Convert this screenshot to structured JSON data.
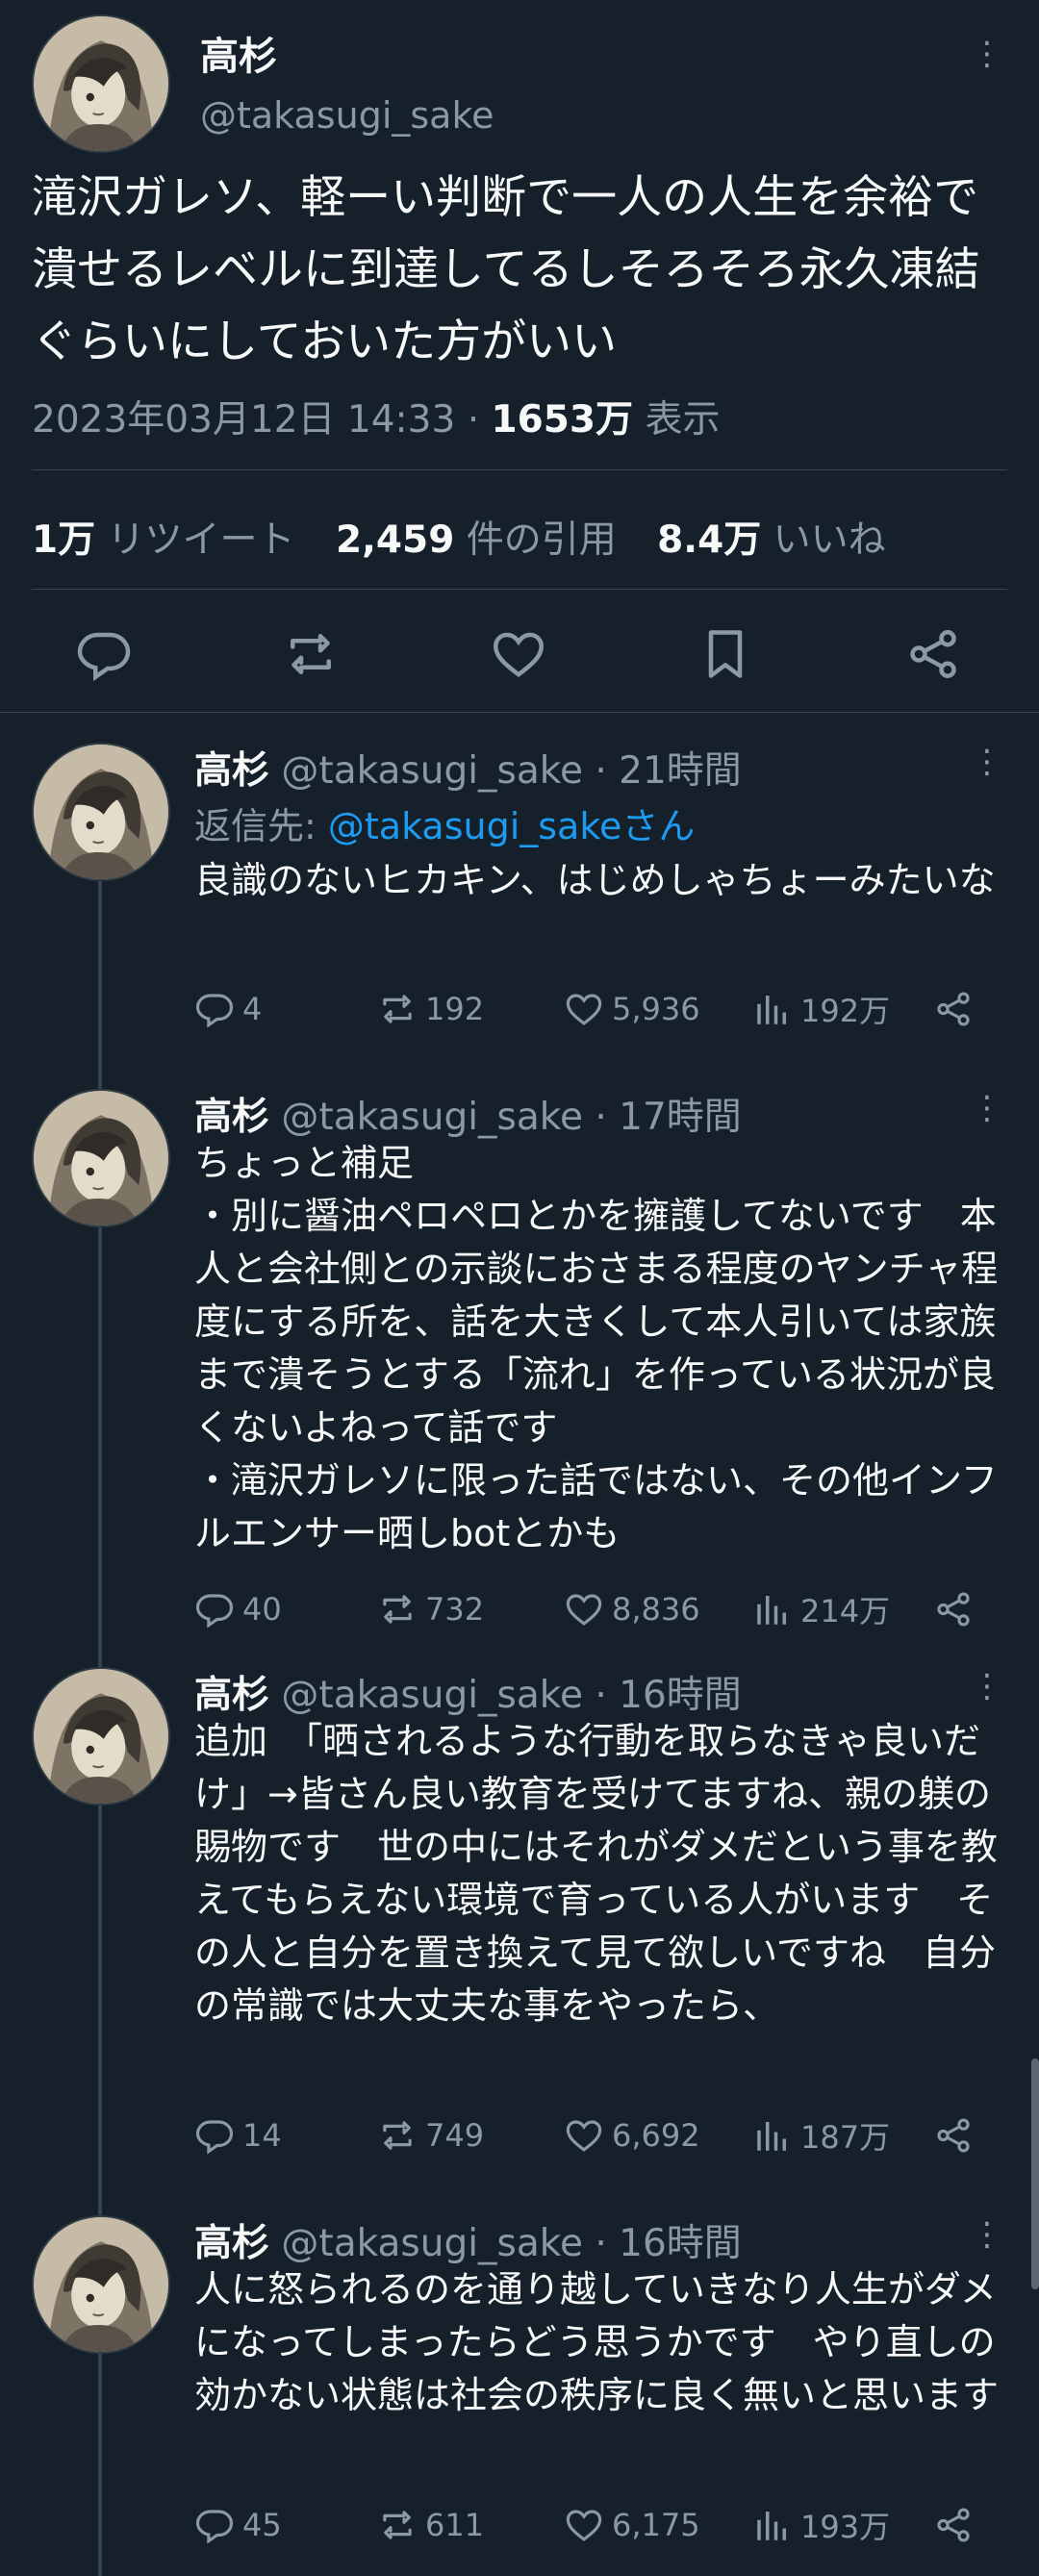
{
  "main_tweet": {
    "author_name": "高杉",
    "handle": "@takasugi_sake",
    "text": "滝沢ガレソ、軽ーい判断で一人の人生を余裕で潰せるレベルに到達してるしそろそろ永久凍結ぐらいにしておいた方がいい",
    "timestamp": "2023年03月12日 14:33",
    "separator": "·",
    "views_count": "1653万",
    "views_label": "表示",
    "retweets_count": "1万",
    "retweets_label": "リツイート",
    "quotes_count": "2,459",
    "quotes_label": "件の引用",
    "likes_count": "8.4万",
    "likes_label": "いいね"
  },
  "replies": [
    {
      "author_name": "高杉",
      "handle": "@takasugi_sake",
      "separator": "·",
      "time": "21時間",
      "reply_to_label": "返信先: ",
      "reply_to_link": "@takasugi_sakeさん",
      "text": "良識のないヒカキン、はじめしゃちょーみたいな",
      "replies": "4",
      "retweets": "192",
      "likes": "5,936",
      "views": "192万"
    },
    {
      "author_name": "高杉",
      "handle": "@takasugi_sake",
      "separator": "·",
      "time": "17時間",
      "text": "ちょっと補足\n・別に醤油ペロペロとかを擁護してないです　本人と会社側との示談におさまる程度のヤンチャ程度にする所を、話を大きくして本人引いては家族まで潰そうとする「流れ」を作っている状況が良くないよねって話です\n・滝沢ガレソに限った話ではない、その他インフルエンサー晒しbotとかも",
      "replies": "40",
      "retweets": "732",
      "likes": "8,836",
      "views": "214万"
    },
    {
      "author_name": "高杉",
      "handle": "@takasugi_sake",
      "separator": "·",
      "time": "16時間",
      "text": "追加　「晒されるような行動を取らなきゃ良いだけ」→皆さん良い教育を受けてますね、親の躾の賜物です　世の中にはそれがダメだという事を教えてもらえない環境で育っている人がいます　その人と自分を置き換えて見て欲しいですね　自分の常識では大丈夫な事をやったら、",
      "replies": "14",
      "retweets": "749",
      "likes": "6,692",
      "views": "187万"
    },
    {
      "author_name": "高杉",
      "handle": "@takasugi_sake",
      "separator": "·",
      "time": "16時間",
      "text": "人に怒られるのを通り越していきなり人生がダメになってしまったらどう思うかです　やり直しの効かない状態は社会の秩序に良く無いと思います",
      "replies": "45",
      "retweets": "611",
      "likes": "6,175",
      "views": "193万"
    }
  ],
  "icons": {
    "more": "more-dots-icon",
    "reply": "reply-bubble-icon",
    "retweet": "retweet-arrows-icon",
    "like": "heart-icon",
    "bookmark": "bookmark-icon",
    "share": "share-icon",
    "views": "bar-chart-icon"
  },
  "colors": {
    "background": "#15202b",
    "text": "#f7f9f9",
    "secondary": "#8b98a5",
    "link": "#1d9bf0",
    "divider": "#38444d"
  }
}
